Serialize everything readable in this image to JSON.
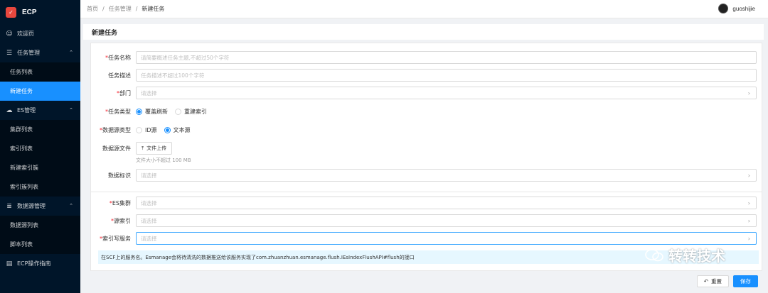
{
  "app": {
    "logo_text": "ECP"
  },
  "sidebar": {
    "items": [
      {
        "label": "欢迎页",
        "icon": "smile-icon"
      },
      {
        "label": "任务管理",
        "icon": "list-icon",
        "group": true
      },
      {
        "label": "任务列表"
      },
      {
        "label": "新建任务",
        "active": true
      },
      {
        "label": "ES管理",
        "icon": "cloud-icon",
        "group": true
      },
      {
        "label": "集群列表"
      },
      {
        "label": "索引列表"
      },
      {
        "label": "新建索引簇"
      },
      {
        "label": "索引簇列表"
      },
      {
        "label": "数据源管理",
        "icon": "database-icon",
        "group": true
      },
      {
        "label": "数据源列表"
      },
      {
        "label": "脚本列表"
      },
      {
        "label": "ECP操作指南",
        "icon": "book-icon"
      }
    ]
  },
  "header": {
    "breadcrumb": [
      "首页",
      "任务管理",
      "新建任务"
    ],
    "separator": "/",
    "username": "guoshijie"
  },
  "page": {
    "title": "新建任务"
  },
  "form": {
    "task_name": {
      "label": "任务名称",
      "placeholder": "请简要概述任务主题,不超过50个字符"
    },
    "task_desc": {
      "label": "任务描述",
      "placeholder": "任务描述不超过100个字符"
    },
    "department": {
      "label": "部门",
      "placeholder": "请选择"
    },
    "task_type": {
      "label": "任务类型",
      "options": [
        "覆盖刷新",
        "重建索引"
      ],
      "selected": "覆盖刷新"
    },
    "source_type": {
      "label": "数据源类型",
      "options": [
        "ID源",
        "文本源"
      ],
      "selected": "文本源"
    },
    "source_file": {
      "label": "数据源文件",
      "button": "文件上传",
      "hint": "文件大小不超过 100 MB"
    },
    "data_id": {
      "label": "数据标识",
      "placeholder": "请选择"
    },
    "es_cluster": {
      "label": "ES集群",
      "placeholder": "请选择"
    },
    "source_index": {
      "label": "源索引",
      "placeholder": "请选择"
    },
    "write_service": {
      "label": "索引写服务",
      "placeholder": "请选择"
    },
    "tip": "在SCF上的服务名。Esmanage会将待清洗的数据推送给该服务实现了com.zhuanzhuan.esmanage.flush.IEsIndexFlushAPI#flush的接口",
    "required_mark": "*"
  },
  "actions": {
    "reset": "重置",
    "save": "保存"
  },
  "watermark": "转转技术",
  "colors": {
    "sidebar_bg": "#001529",
    "primary": "#1890ff",
    "brand_red": "#e8473e"
  }
}
